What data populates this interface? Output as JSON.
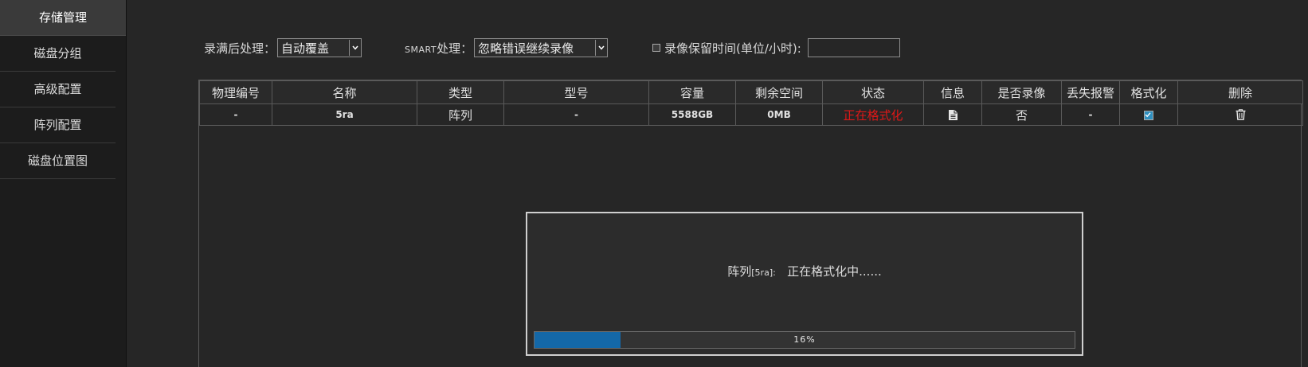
{
  "sidebar": {
    "items": [
      {
        "label": "存储管理",
        "active": true
      },
      {
        "label": "磁盘分组",
        "active": false
      },
      {
        "label": "高级配置",
        "active": false
      },
      {
        "label": "阵列配置",
        "active": false
      },
      {
        "label": "磁盘位置图",
        "active": false
      }
    ]
  },
  "toolbar": {
    "full_label": "录满后处理：",
    "full_value": "自动覆盖",
    "smart_label_prefix": "SMART",
    "smart_label_suffix": "处理：",
    "smart_value": "忽略错误继续录像",
    "retention_label": "录像保留时间(单位/小时):",
    "retention_value": ""
  },
  "table": {
    "columns": [
      "物理编号",
      "名称",
      "类型",
      "型号",
      "容量",
      "剩余空间",
      "状态",
      "信息",
      "是否录像",
      "丢失报警",
      "格式化",
      "删除"
    ],
    "rows": [
      {
        "physical_id": "-",
        "name": "5ra",
        "type": "阵列",
        "model": "-",
        "capacity": "5588GB",
        "free_space": "0MB",
        "status": "正在格式化",
        "info_icon": "document-icon",
        "recording": "否",
        "loss_alarm": "-",
        "format_checked": true,
        "delete_icon": "trash-icon"
      }
    ]
  },
  "dialog": {
    "prefix": "阵列",
    "tag": "[5ra]:",
    "message": "正在格式化中......",
    "progress_percent": 16,
    "progress_text": "16%"
  },
  "colors": {
    "status_red": "#e01818",
    "progress_blue": "#1468a8",
    "checkbox_blue": "#2f8fbf"
  }
}
